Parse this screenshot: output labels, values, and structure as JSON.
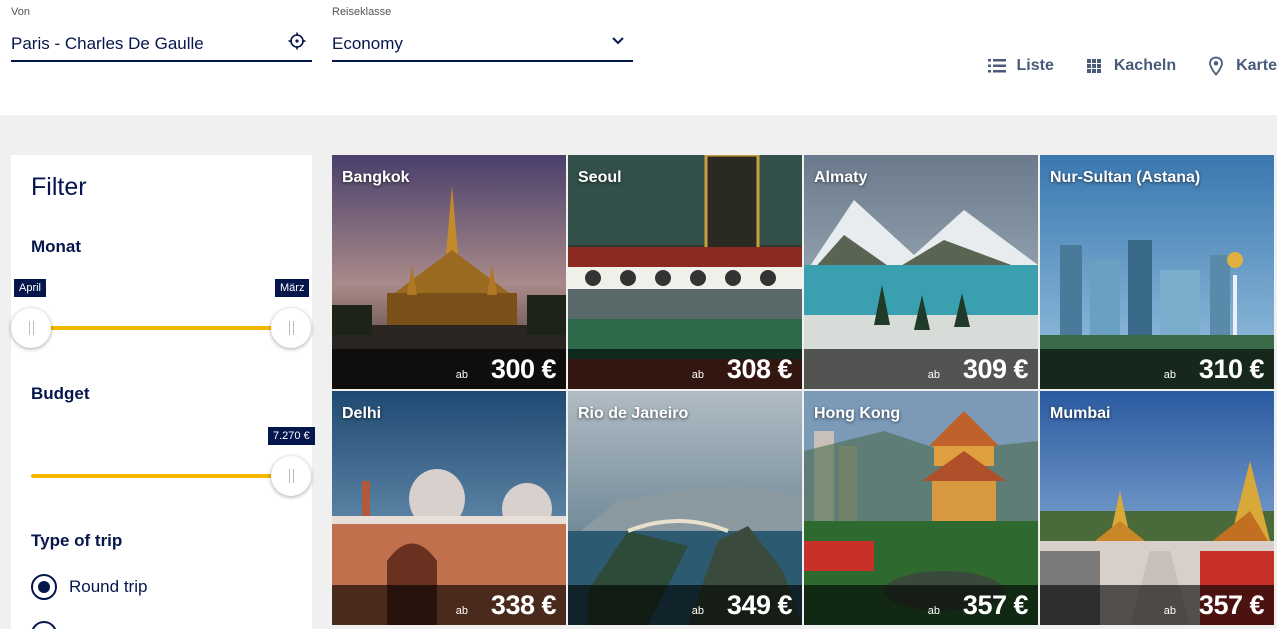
{
  "search": {
    "from_label": "Von",
    "from_value": "Paris - Charles De Gaulle",
    "class_label": "Reiseklasse",
    "class_value": "Economy"
  },
  "views": [
    {
      "label": "Liste",
      "icon": "list-icon"
    },
    {
      "label": "Kacheln",
      "icon": "grid-icon"
    },
    {
      "label": "Karte",
      "icon": "map-pin-icon"
    }
  ],
  "filter": {
    "title": "Filter",
    "month": {
      "title": "Monat",
      "min_label": "April",
      "max_label": "März"
    },
    "budget": {
      "title": "Budget",
      "max_label": "7.270 €"
    },
    "trip_type": {
      "title": "Type of trip",
      "options": [
        "Round trip"
      ],
      "selected": "Round trip"
    }
  },
  "destinations": [
    {
      "name": "Bangkok",
      "prefix": "ab",
      "price": "300 €"
    },
    {
      "name": "Seoul",
      "prefix": "ab",
      "price": "308 €"
    },
    {
      "name": "Almaty",
      "prefix": "ab",
      "price": "309 €"
    },
    {
      "name": "Nur-Sultan (Astana)",
      "prefix": "ab",
      "price": "310 €"
    },
    {
      "name": "Delhi",
      "prefix": "ab",
      "price": "338 €"
    },
    {
      "name": "Rio de Janeiro",
      "prefix": "ab",
      "price": "349 €"
    },
    {
      "name": "Hong Kong",
      "prefix": "ab",
      "price": "357 €"
    },
    {
      "name": "Mumbai",
      "prefix": "ab",
      "price": "357 €"
    }
  ],
  "colors": {
    "brand_navy": "#05164d",
    "accent_yellow": "#f5b800"
  }
}
